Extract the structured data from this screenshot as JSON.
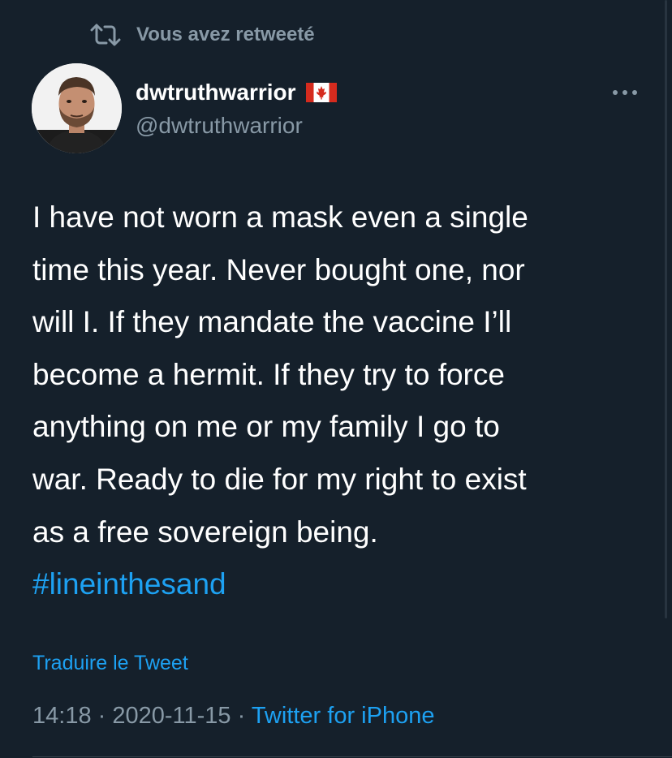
{
  "retweet": {
    "icon": "retweet-icon",
    "label": "Vous avez retweeté"
  },
  "user": {
    "display_name": "dwtruthwarrior",
    "flag_icon": "canada-flag-icon",
    "handle": "@dwtruthwarrior",
    "avatar_icon": "profile-photo"
  },
  "tweet": {
    "lines": [
      "I have not worn a mask even a single",
      "time this year. Never bought one, nor",
      "will I. If they mandate the vaccine I’ll",
      "become a hermit. If they try to force",
      "anything on me or my family I go to",
      "war. Ready to die for my right to exist",
      "as a free sovereign being."
    ],
    "hashtag": "#lineinthesand"
  },
  "translate_label": "Traduire le Tweet",
  "meta": {
    "time": "14:18",
    "sep1": " · ",
    "date": "2020-11-15",
    "sep2": " · ",
    "source": "Twitter for iPhone"
  },
  "more_icon": "more-options-icon",
  "colors": {
    "background": "#15202b",
    "text": "#ffffff",
    "muted": "#8899a6",
    "accent": "#1da1f2"
  }
}
